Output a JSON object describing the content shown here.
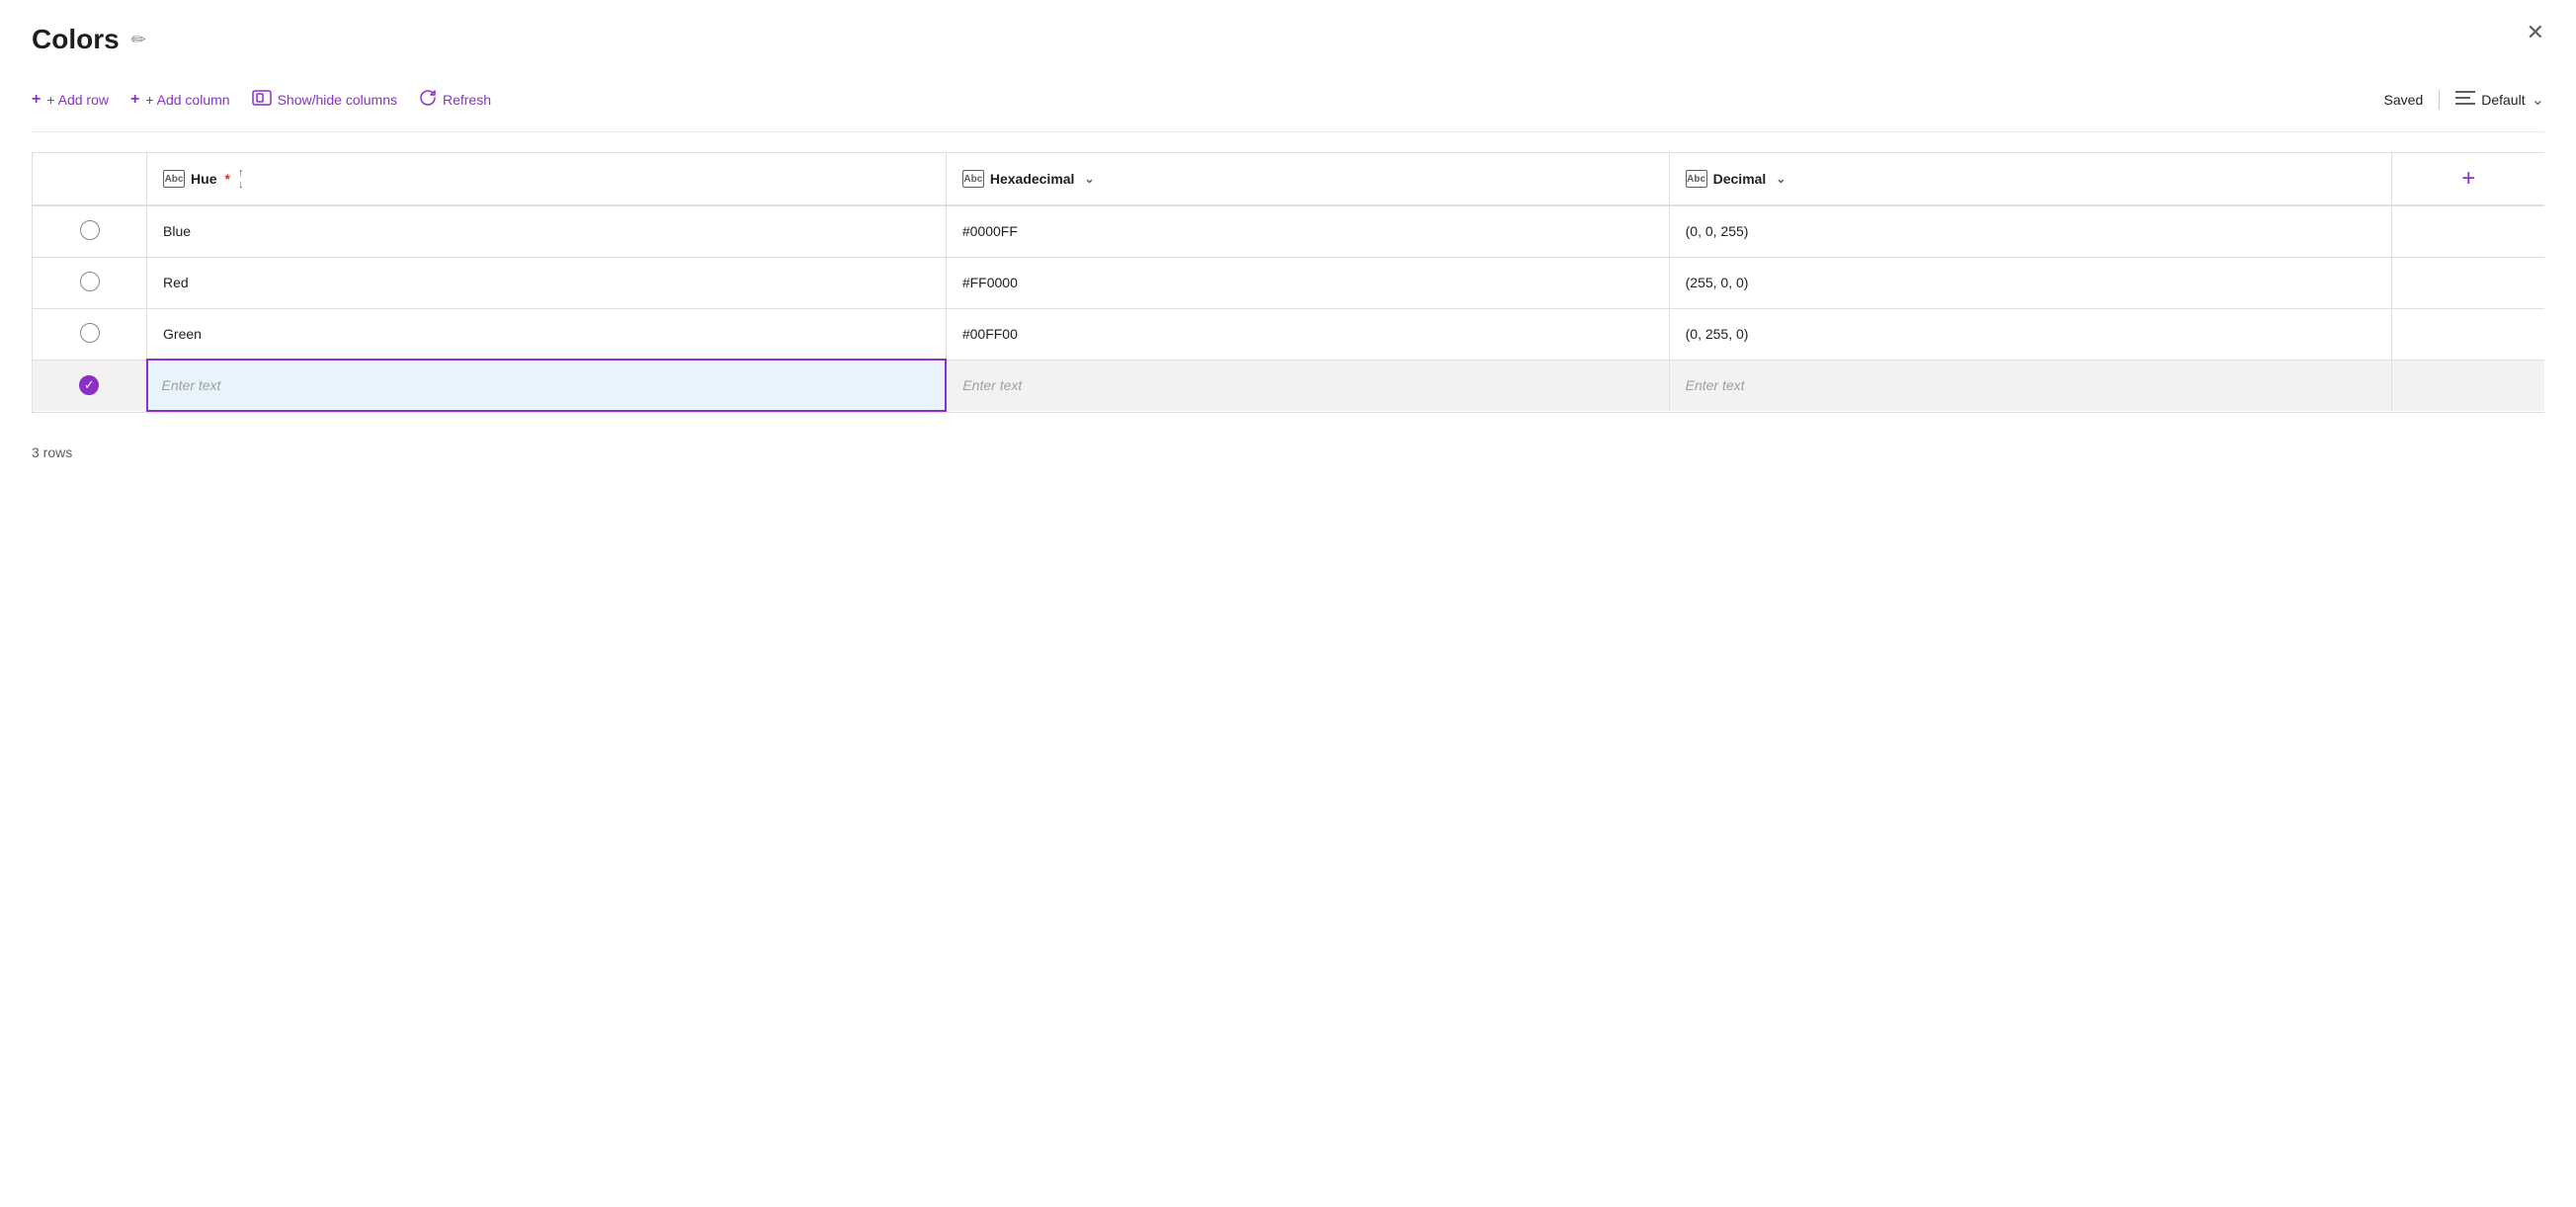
{
  "page": {
    "title": "Colors",
    "rows_count": "3 rows"
  },
  "toolbar": {
    "add_row": "+ Add row",
    "add_column": "+ Add column",
    "show_hide": "Show/hide columns",
    "refresh": "Refresh",
    "saved": "Saved",
    "default": "Default"
  },
  "table": {
    "columns": [
      {
        "id": "hue",
        "label": "Hue",
        "required": true,
        "type": "Abc",
        "sortable": true,
        "filterable": false
      },
      {
        "id": "hexadecimal",
        "label": "Hexadecimal",
        "required": false,
        "type": "Abc",
        "sortable": false,
        "filterable": true
      },
      {
        "id": "decimal",
        "label": "Decimal",
        "required": false,
        "type": "Abc",
        "sortable": false,
        "filterable": true
      }
    ],
    "rows": [
      {
        "id": 1,
        "hue": "Blue",
        "hexadecimal": "#0000FF",
        "decimal": "(0, 0, 255)",
        "selected": false
      },
      {
        "id": 2,
        "hue": "Red",
        "hexadecimal": "#FF0000",
        "decimal": "(255, 0, 0)",
        "selected": false
      },
      {
        "id": 3,
        "hue": "Green",
        "hexadecimal": "#00FF00",
        "decimal": "(0, 255, 0)",
        "selected": false
      }
    ],
    "new_row": {
      "placeholder": "Enter text",
      "selected": true
    }
  },
  "icons": {
    "edit": "✏",
    "close": "✕",
    "plus": "+",
    "chevron_down": "⌄",
    "sort_up": "↑",
    "sort_down": "↓",
    "check": "✓"
  },
  "colors": {
    "accent": "#8b2fc9",
    "border": "#e1dfdd",
    "text_primary": "#201f1e",
    "text_secondary": "#605e5c",
    "placeholder": "#a19f9d"
  }
}
